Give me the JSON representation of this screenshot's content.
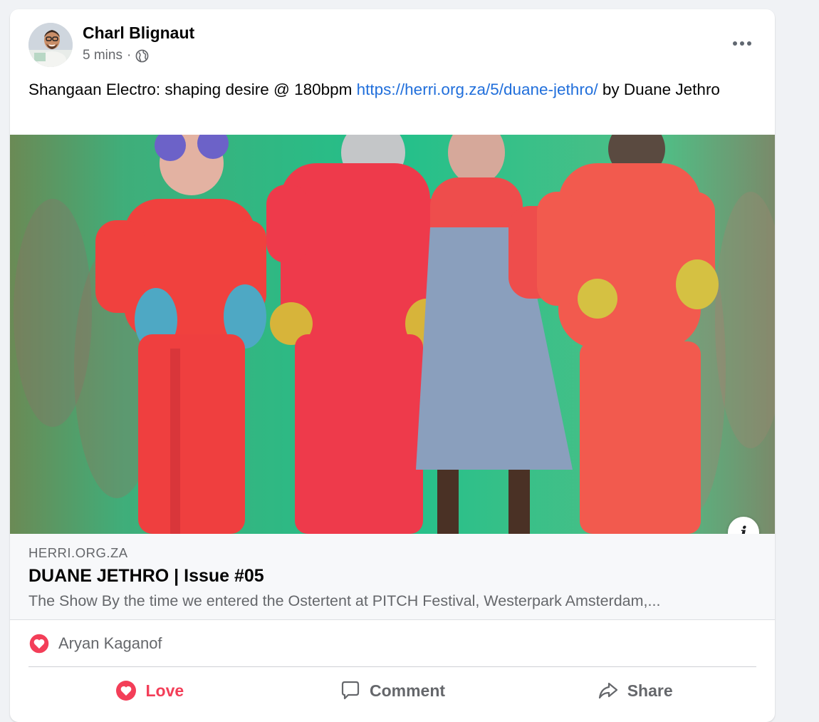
{
  "post": {
    "author": "Charl Blignaut",
    "time": "5 mins",
    "separator": "·",
    "text_prefix": "Shangaan Electro: shaping desire @ 180bpm ",
    "link_text": "https://herri.org.za/5/duane-jethro/",
    "text_suffix": " by Duane Jethro"
  },
  "link_preview": {
    "domain": "HERRI.ORG.ZA",
    "title": "DUANE JETHRO | Issue #05",
    "description": "The Show By the time we entered the Ostertent at PITCH Festival, Westerpark Amsterdam,..."
  },
  "reactions": {
    "icon": "love-reaction-icon",
    "names": "Aryan Kaganof"
  },
  "actions": {
    "love": "Love",
    "comment": "Comment",
    "share": "Share"
  },
  "colors": {
    "link": "#216fdb",
    "love": "#f33e58",
    "secondary_text": "#65676b"
  }
}
